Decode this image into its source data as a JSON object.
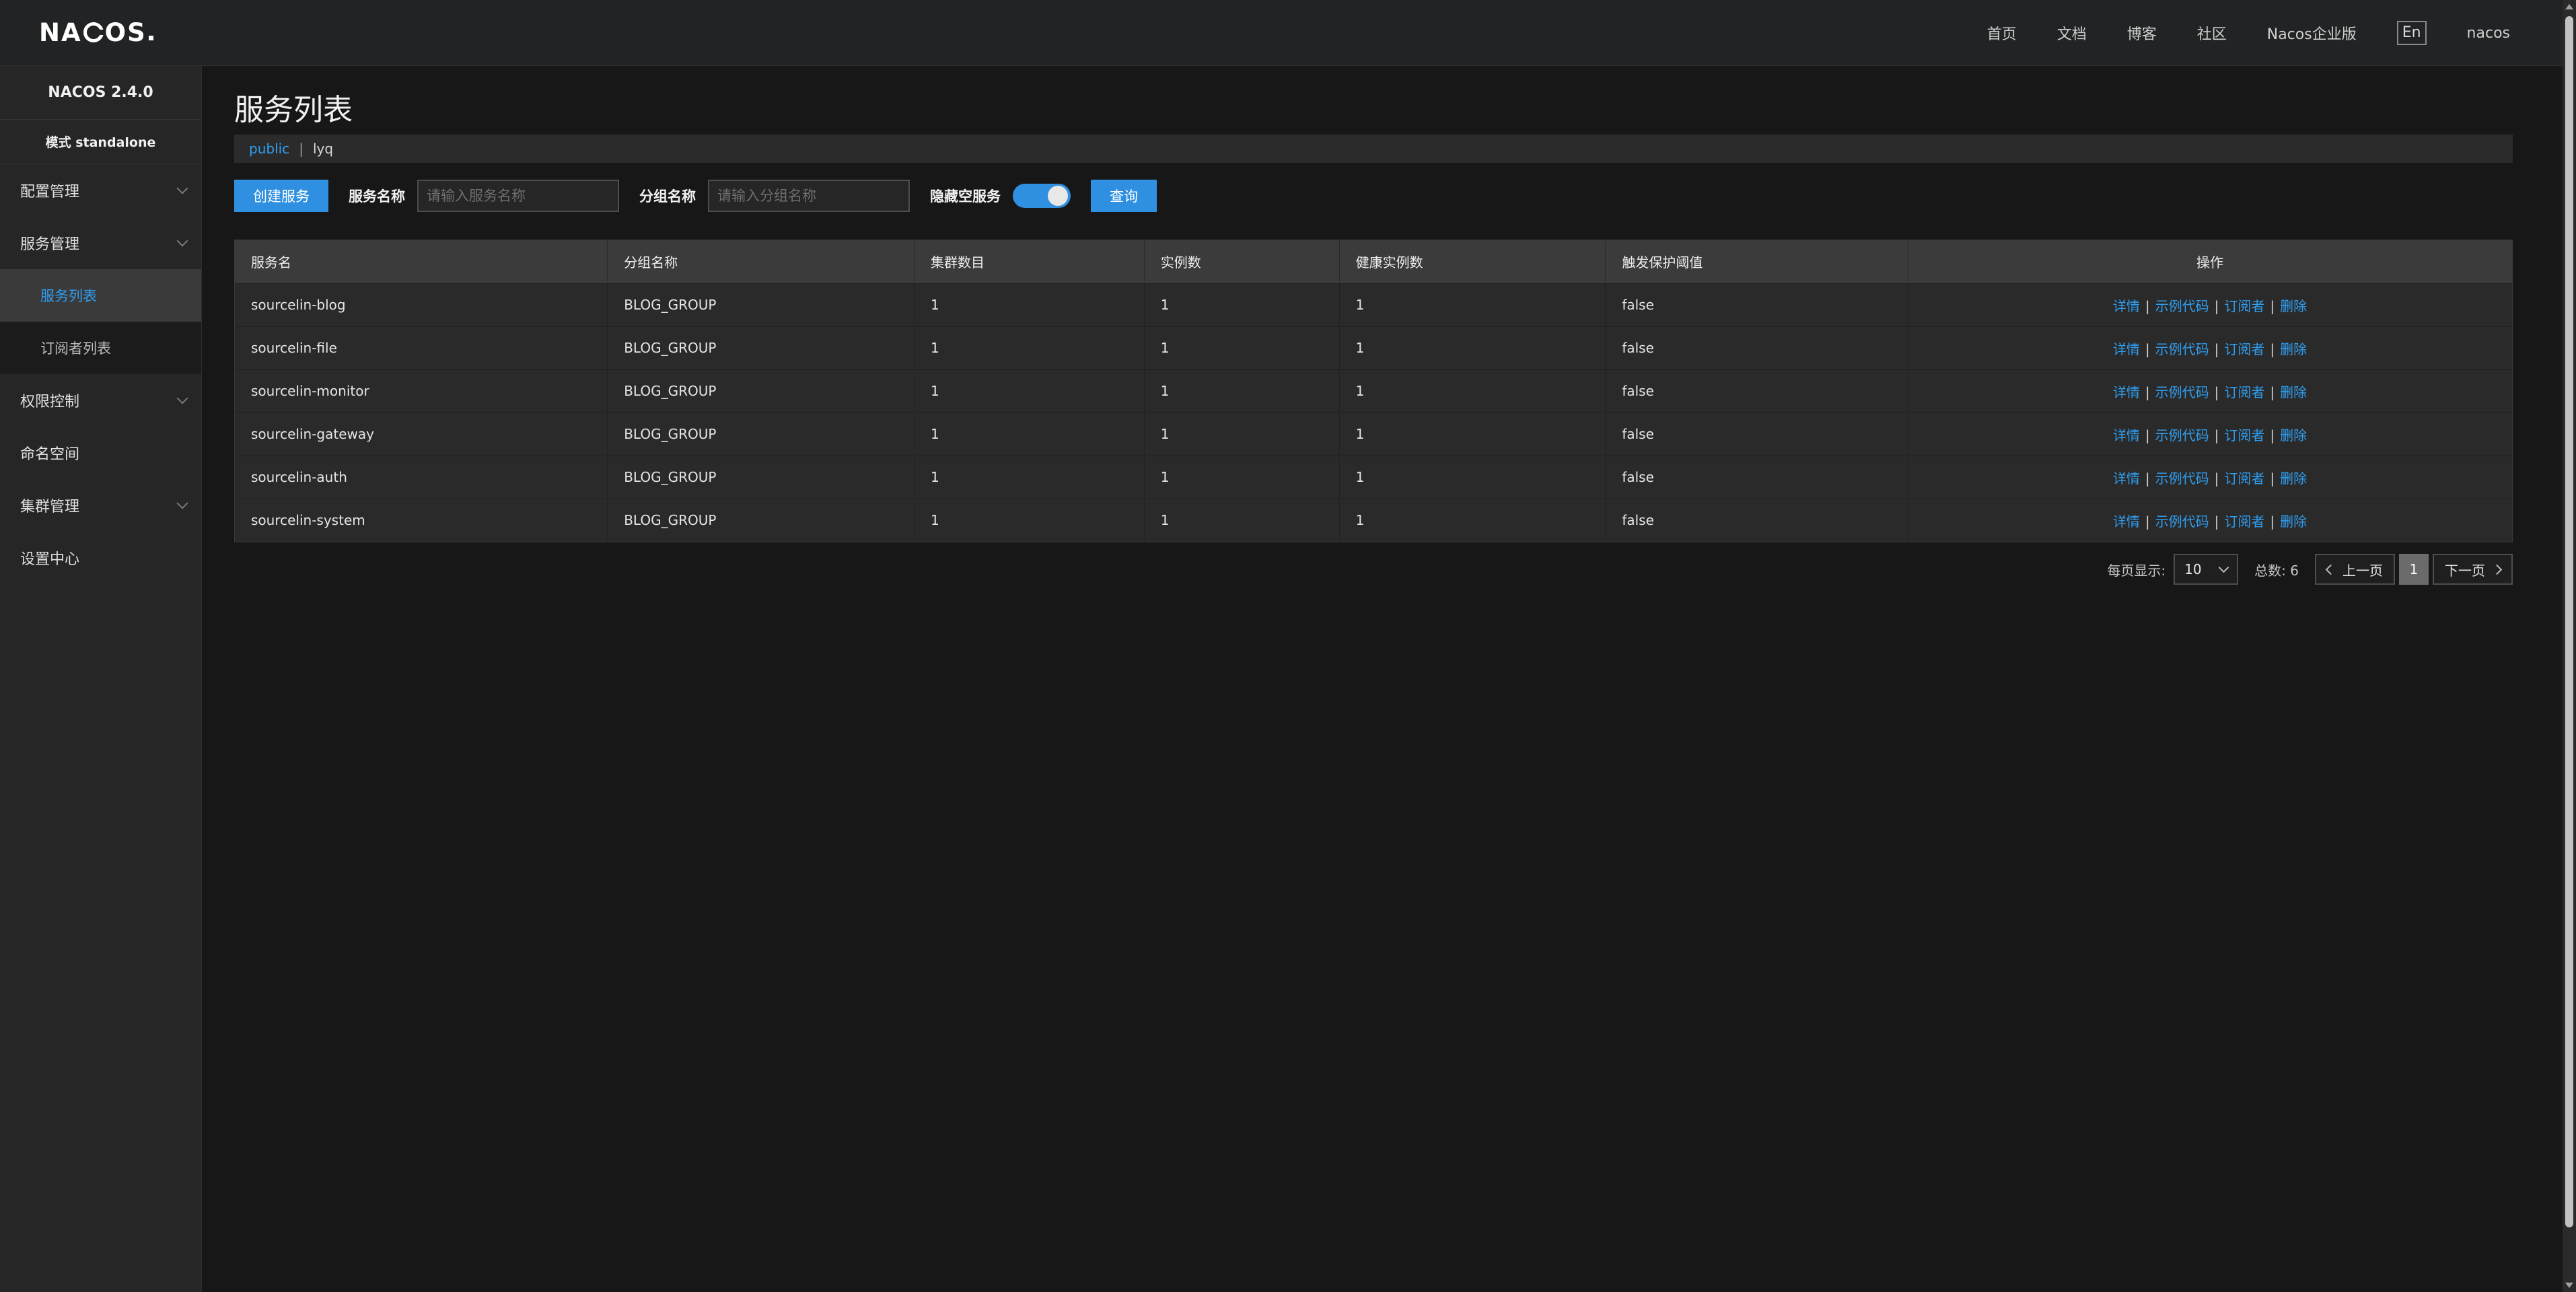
{
  "header": {
    "logo_text": "NACOS.",
    "nav": [
      "首页",
      "文档",
      "博客",
      "社区",
      "Nacos企业版"
    ],
    "lang_toggle": "En",
    "user": "nacos"
  },
  "sidebar": {
    "version": "NACOS 2.4.0",
    "mode": "模式 standalone",
    "items": [
      {
        "label": "配置管理",
        "expandable": true
      },
      {
        "label": "服务管理",
        "expandable": true
      },
      {
        "label": "服务列表",
        "sub": true,
        "active": true
      },
      {
        "label": "订阅者列表",
        "sub": true,
        "active": false
      },
      {
        "label": "权限控制",
        "expandable": true
      },
      {
        "label": "命名空间",
        "expandable": false
      },
      {
        "label": "集群管理",
        "expandable": true
      },
      {
        "label": "设置中心",
        "expandable": false
      }
    ]
  },
  "page": {
    "title": "服务列表",
    "namespaces": {
      "public": "public",
      "separator": "|",
      "current": "lyq"
    }
  },
  "filter": {
    "create_button": "创建服务",
    "service_name_label": "服务名称",
    "service_name_placeholder": "请输入服务名称",
    "group_name_label": "分组名称",
    "group_name_placeholder": "请输入分组名称",
    "hide_empty_label": "隐藏空服务",
    "hide_empty_on": true,
    "query_button": "查询"
  },
  "table": {
    "columns": [
      "服务名",
      "分组名称",
      "集群数目",
      "实例数",
      "健康实例数",
      "触发保护阈值",
      "操作"
    ],
    "actions": [
      "详情",
      "示例代码",
      "订阅者",
      "删除"
    ],
    "action_separator": "|",
    "rows": [
      [
        "sourcelin-blog",
        "BLOG_GROUP",
        "1",
        "1",
        "1",
        "false"
      ],
      [
        "sourcelin-file",
        "BLOG_GROUP",
        "1",
        "1",
        "1",
        "false"
      ],
      [
        "sourcelin-monitor",
        "BLOG_GROUP",
        "1",
        "1",
        "1",
        "false"
      ],
      [
        "sourcelin-gateway",
        "BLOG_GROUP",
        "1",
        "1",
        "1",
        "false"
      ],
      [
        "sourcelin-auth",
        "BLOG_GROUP",
        "1",
        "1",
        "1",
        "false"
      ],
      [
        "sourcelin-system",
        "BLOG_GROUP",
        "1",
        "1",
        "1",
        "false"
      ]
    ]
  },
  "pagination": {
    "per_page_label": "每页显示:",
    "per_page_value": "10",
    "total_label": "总数: 6",
    "prev": "上一页",
    "current_page": "1",
    "next": "下一页"
  },
  "colors": {
    "accent": "#2f8fe0",
    "link": "#2f9ef0",
    "background": "#171717",
    "sidebar": "#262626",
    "topbar": "#222324"
  }
}
